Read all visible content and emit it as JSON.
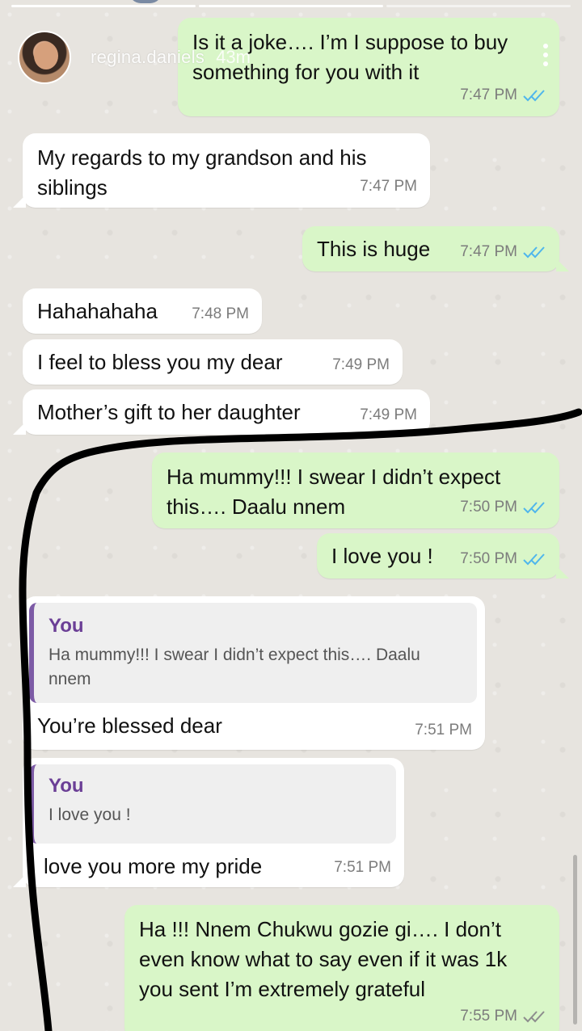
{
  "story": {
    "username": "regina.daniels",
    "time_ago": "43m"
  },
  "messages": [
    {
      "id": "m1",
      "direction": "out",
      "text": "Is it a joke…. I’m I suppose to buy something for you with it",
      "time": "7:47 PM",
      "read": true
    },
    {
      "id": "m2",
      "direction": "in",
      "text": "My regards to my grandson and his siblings",
      "time": "7:47 PM"
    },
    {
      "id": "m3",
      "direction": "out",
      "text": "This is huge",
      "time": "7:47 PM",
      "read": true
    },
    {
      "id": "m4",
      "direction": "in",
      "text": "Hahahahaha",
      "time": "7:48 PM"
    },
    {
      "id": "m5",
      "direction": "in",
      "text": "I feel to bless you my dear",
      "time": "7:49 PM"
    },
    {
      "id": "m6",
      "direction": "in",
      "text": "Mother’s gift to her daughter",
      "time": "7:49 PM"
    },
    {
      "id": "m7",
      "direction": "out",
      "text": "Ha mummy!!! I swear I didn’t expect this…. Daalu nnem",
      "time": "7:50 PM",
      "read": true
    },
    {
      "id": "m8",
      "direction": "out",
      "text": "I love you !",
      "time": "7:50 PM",
      "read": true
    },
    {
      "id": "m9",
      "direction": "in",
      "quote_author": "You",
      "quote_text": "Ha mummy!!! I swear I didn’t expect this…. Daalu nnem",
      "text": "You’re blessed dear",
      "time": "7:51 PM"
    },
    {
      "id": "m10",
      "direction": "in",
      "quote_author": "You",
      "quote_text": "I love you !",
      "text": "love you more my pride",
      "time": "7:51 PM"
    },
    {
      "id": "m11",
      "direction": "out",
      "text": "Ha !!! Nnem Chukwu gozie gi…. I don’t even know what to say even if it was 1k you sent I’m extremely grateful",
      "time": "7:55 PM",
      "read": false
    }
  ],
  "colors": {
    "outgoing_bubble": "#d9f6c8",
    "incoming_bubble": "#ffffff",
    "read_tick": "#4fb6ec",
    "quote_accent": "#7d5ba6",
    "marker_stroke": "#000000"
  },
  "icons": [
    "double-check-icon",
    "menu-dots-icon"
  ]
}
